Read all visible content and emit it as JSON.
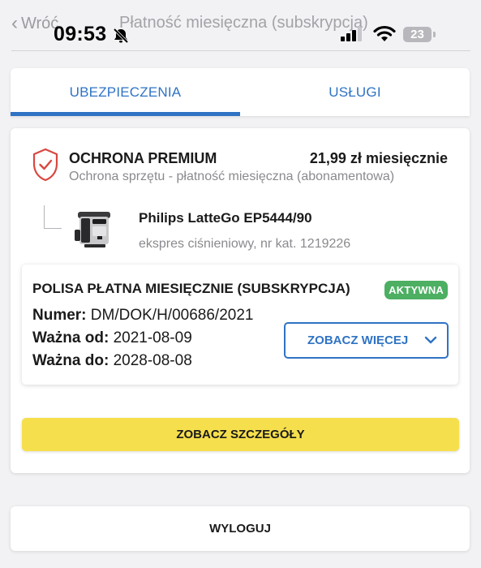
{
  "status_bar": {
    "time": "09:53",
    "battery": "23"
  },
  "nav": {
    "back_label": "Wróć",
    "title": "Płatność miesięczna (subskrypcja)"
  },
  "tabs": [
    {
      "label": "UBEZPIECZENIA",
      "active": true
    },
    {
      "label": "USŁUGI",
      "active": false
    }
  ],
  "product": {
    "name": "OCHRONA PREMIUM",
    "price": "21,99 zł miesięcznie",
    "description": "Ochrona sprzętu - płatność miesięczna (abonamentowa)"
  },
  "device": {
    "name": "Philips LatteGo EP5444/90",
    "details": "ekspres ciśnieniowy, nr kat. 1219226"
  },
  "policy": {
    "title": "POLISA PŁATNA MIESIĘCZNIE (SUBSKRYPCJA)",
    "status": "AKTYWNA",
    "number_label": "Numer:",
    "number_value": "DM/DOK/H/00686/2021",
    "valid_from_label": "Ważna od:",
    "valid_from_value": "2021-08-09",
    "valid_to_label": "Ważna do:",
    "valid_to_value": "2028-08-08",
    "more_label": "ZOBACZ WIĘCEJ"
  },
  "actions": {
    "details_label": "ZOBACZ SZCZEGÓŁY",
    "logout_label": "WYLOGUJ"
  },
  "colors": {
    "accent_blue": "#2f73c4",
    "active_green": "#4caf62",
    "primary_yellow": "#f6df4d",
    "shield_red": "#d9473f"
  }
}
